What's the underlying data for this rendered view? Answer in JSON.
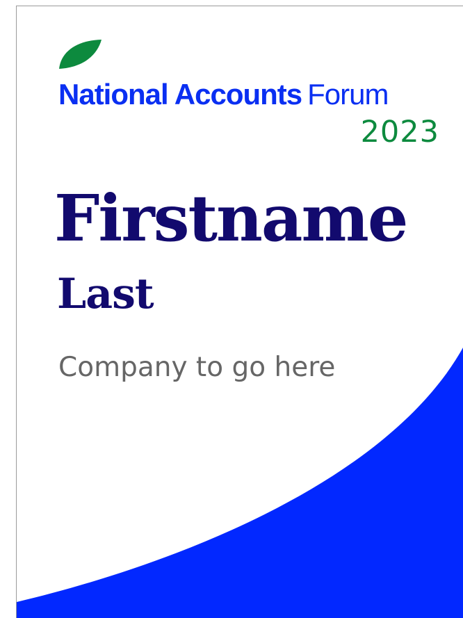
{
  "event": {
    "brand_bold": "National Accounts",
    "brand_light": "Forum",
    "year": "2023"
  },
  "attendee": {
    "first_name": "Firstname",
    "last_name": "Last",
    "company": "Company to go here"
  },
  "icons": {
    "logo": "leaf-icon"
  },
  "colors": {
    "brand_blue": "#0a2ff2",
    "accent_green": "#0d8a3e",
    "name_navy": "#120a6e",
    "company_gray": "#666666",
    "swoosh_blue": "#0228ff",
    "background": "#ffffff"
  }
}
